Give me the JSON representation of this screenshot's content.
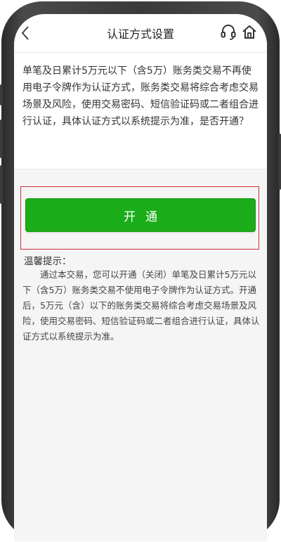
{
  "nav": {
    "title": "认证方式设置",
    "back_icon": "chevron-left-icon",
    "service_icon": "headset-icon",
    "home_icon": "home-icon"
  },
  "description": "单笔及日累计5万元以下（含5万）账务类交易不再使用电子令牌作为认证方式，账务类交易将综合考虑交易场景及风险，使用交易密码、短信验证码或二者组合进行认证，具体认证方式以系统提示为准，是否开通？",
  "open_button": {
    "label": "开通"
  },
  "tips": {
    "title": "温馨提示：",
    "body": "通过本交易，您可以开通（关闭）单笔及日累计5万元以下（含5万）账务类交易不使用电子令牌作为认证方式。开通后，5万元（含）以下的账务类交易将综合考虑交易场景及风险，使用交易密码、短信验证码或二者组合进行认证，具体认证方式以系统提示为准。"
  },
  "colors": {
    "primary_button": "#1aad19",
    "highlight_border": "#c9303a",
    "background": "#f5f5f5"
  }
}
